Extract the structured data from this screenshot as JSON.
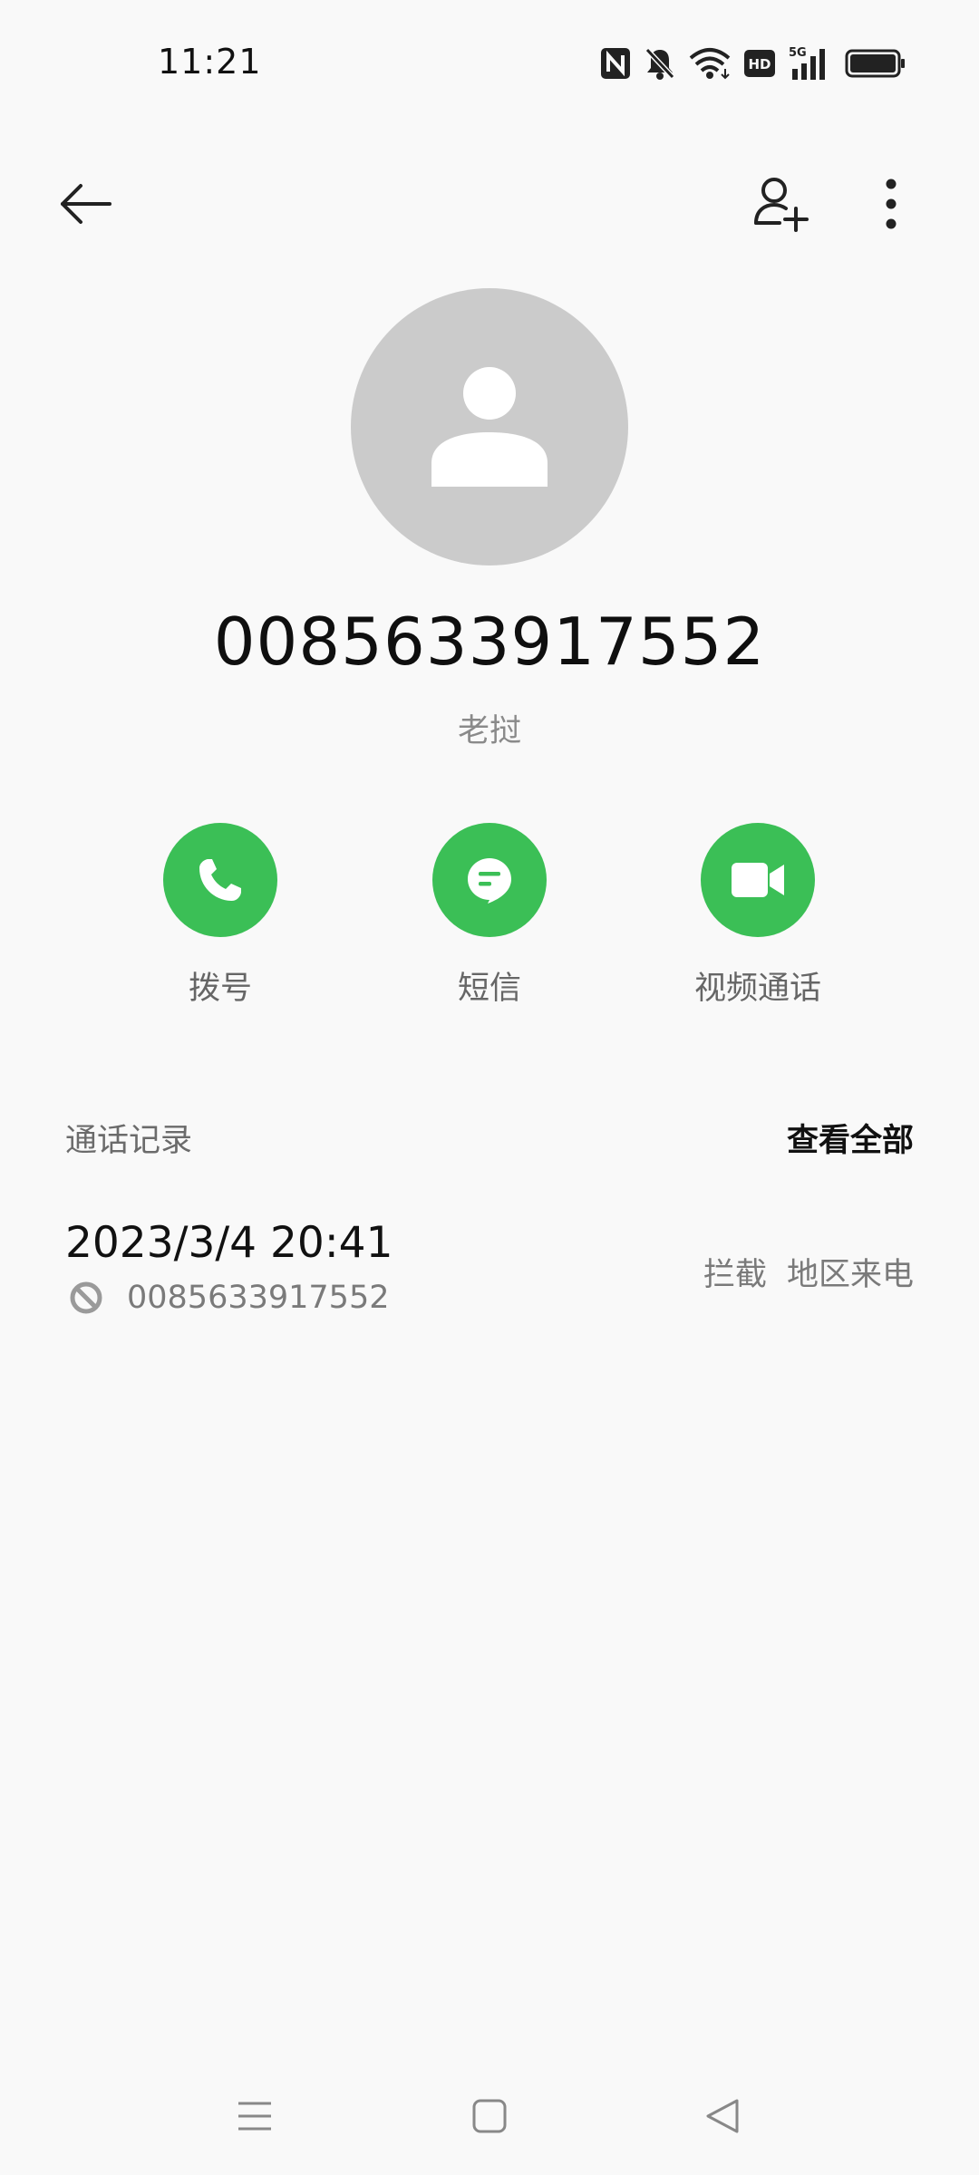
{
  "status_bar": {
    "time": "11:21",
    "icons": [
      "nfc-icon",
      "bell-off-icon",
      "wifi-icon",
      "hd-icon",
      "signal-5g-icon",
      "battery-icon"
    ],
    "hd_label": "HD",
    "network_label": "5G"
  },
  "app_bar": {
    "back_icon": "arrow-left-icon",
    "add_contact_icon": "person-add-icon",
    "more_icon": "more-vertical-icon"
  },
  "contact": {
    "number": "0085633917552",
    "subtitle": "老挝"
  },
  "actions": [
    {
      "label": "拨号",
      "icon": "phone-icon"
    },
    {
      "label": "短信",
      "icon": "message-icon"
    },
    {
      "label": "视频通话",
      "icon": "video-icon"
    }
  ],
  "call_log": {
    "title": "通话记录",
    "view_all": "查看全部",
    "entries": [
      {
        "datetime": "2023/3/4 20:41",
        "number": "0085633917552",
        "status": "拦截",
        "type": "地区来电",
        "icon": "block-icon"
      }
    ]
  },
  "colors": {
    "accent": "#3bbf56",
    "background": "#f9f9f9",
    "avatar": "#cbcbcb"
  },
  "nav_bar": {
    "icons": [
      "menu-icon",
      "home-square-icon",
      "back-triangle-icon"
    ]
  }
}
